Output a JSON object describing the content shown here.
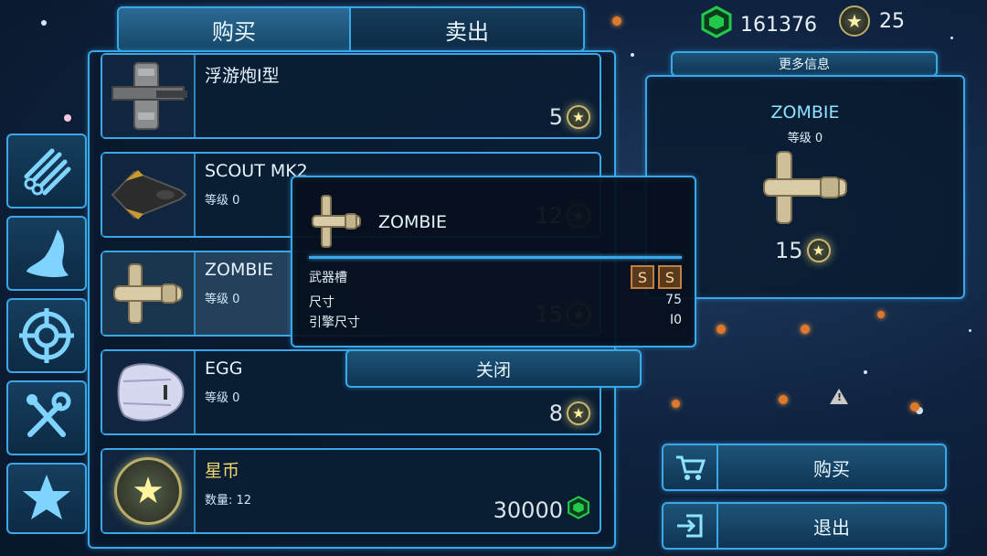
{
  "currency": {
    "credits": "161376",
    "stars": "25",
    "credit_icon": "hexagon-credit-icon",
    "star_icon": "star-coin-icon"
  },
  "tabs": {
    "buy": "购买",
    "sell": "卖出"
  },
  "side_nav": [
    {
      "icon": "weapons-icon"
    },
    {
      "icon": "ship-hull-icon"
    },
    {
      "icon": "target-icon"
    },
    {
      "icon": "tools-icon"
    },
    {
      "icon": "star-icon"
    }
  ],
  "shop_items": [
    {
      "name": "浮游炮I型",
      "level": "",
      "price": "5"
    },
    {
      "name": "SCOUT MK2",
      "level": "等级 0",
      "price": "12"
    },
    {
      "name": "ZOMBIE",
      "level": "等级 0",
      "price": "15"
    },
    {
      "name": "EGG",
      "level": "等级 0",
      "price": "8"
    },
    {
      "name": "星币",
      "level": "数量: 12",
      "price": "30000"
    }
  ],
  "popup": {
    "title": "ZOMBIE",
    "weapon_slots_label": "武器槽",
    "weapon_slots": [
      "S",
      "S"
    ],
    "size_label": "尺寸",
    "size_value": "75",
    "engine_size_label": "引擎尺寸",
    "engine_size_value": "I0",
    "close_label": "关闭"
  },
  "info": {
    "more_info_label": "更多信息",
    "ship_name": "ZOMBIE",
    "ship_level": "等级 0",
    "price": "15"
  },
  "actions": {
    "buy_label": "购买",
    "exit_label": "退出"
  },
  "colors": {
    "accent": "#3aa8e8",
    "credit_green": "#22c94a",
    "star_gold": "#fff3a0",
    "slot_brown": "#5a3a1c"
  }
}
